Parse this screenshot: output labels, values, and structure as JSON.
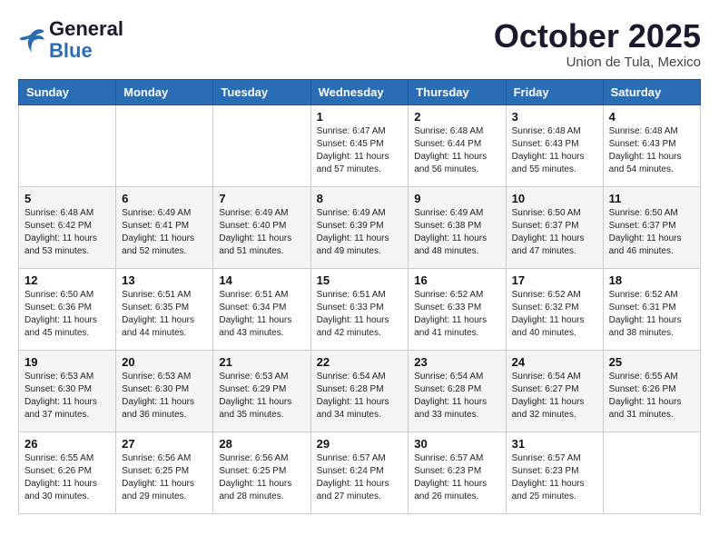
{
  "header": {
    "logo_line1": "General",
    "logo_line2": "Blue",
    "month": "October 2025",
    "location": "Union de Tula, Mexico"
  },
  "weekdays": [
    "Sunday",
    "Monday",
    "Tuesday",
    "Wednesday",
    "Thursday",
    "Friday",
    "Saturday"
  ],
  "weeks": [
    [
      {
        "day": "",
        "info": ""
      },
      {
        "day": "",
        "info": ""
      },
      {
        "day": "",
        "info": ""
      },
      {
        "day": "1",
        "info": "Sunrise: 6:47 AM\nSunset: 6:45 PM\nDaylight: 11 hours\nand 57 minutes."
      },
      {
        "day": "2",
        "info": "Sunrise: 6:48 AM\nSunset: 6:44 PM\nDaylight: 11 hours\nand 56 minutes."
      },
      {
        "day": "3",
        "info": "Sunrise: 6:48 AM\nSunset: 6:43 PM\nDaylight: 11 hours\nand 55 minutes."
      },
      {
        "day": "4",
        "info": "Sunrise: 6:48 AM\nSunset: 6:43 PM\nDaylight: 11 hours\nand 54 minutes."
      }
    ],
    [
      {
        "day": "5",
        "info": "Sunrise: 6:48 AM\nSunset: 6:42 PM\nDaylight: 11 hours\nand 53 minutes."
      },
      {
        "day": "6",
        "info": "Sunrise: 6:49 AM\nSunset: 6:41 PM\nDaylight: 11 hours\nand 52 minutes."
      },
      {
        "day": "7",
        "info": "Sunrise: 6:49 AM\nSunset: 6:40 PM\nDaylight: 11 hours\nand 51 minutes."
      },
      {
        "day": "8",
        "info": "Sunrise: 6:49 AM\nSunset: 6:39 PM\nDaylight: 11 hours\nand 49 minutes."
      },
      {
        "day": "9",
        "info": "Sunrise: 6:49 AM\nSunset: 6:38 PM\nDaylight: 11 hours\nand 48 minutes."
      },
      {
        "day": "10",
        "info": "Sunrise: 6:50 AM\nSunset: 6:37 PM\nDaylight: 11 hours\nand 47 minutes."
      },
      {
        "day": "11",
        "info": "Sunrise: 6:50 AM\nSunset: 6:37 PM\nDaylight: 11 hours\nand 46 minutes."
      }
    ],
    [
      {
        "day": "12",
        "info": "Sunrise: 6:50 AM\nSunset: 6:36 PM\nDaylight: 11 hours\nand 45 minutes."
      },
      {
        "day": "13",
        "info": "Sunrise: 6:51 AM\nSunset: 6:35 PM\nDaylight: 11 hours\nand 44 minutes."
      },
      {
        "day": "14",
        "info": "Sunrise: 6:51 AM\nSunset: 6:34 PM\nDaylight: 11 hours\nand 43 minutes."
      },
      {
        "day": "15",
        "info": "Sunrise: 6:51 AM\nSunset: 6:33 PM\nDaylight: 11 hours\nand 42 minutes."
      },
      {
        "day": "16",
        "info": "Sunrise: 6:52 AM\nSunset: 6:33 PM\nDaylight: 11 hours\nand 41 minutes."
      },
      {
        "day": "17",
        "info": "Sunrise: 6:52 AM\nSunset: 6:32 PM\nDaylight: 11 hours\nand 40 minutes."
      },
      {
        "day": "18",
        "info": "Sunrise: 6:52 AM\nSunset: 6:31 PM\nDaylight: 11 hours\nand 38 minutes."
      }
    ],
    [
      {
        "day": "19",
        "info": "Sunrise: 6:53 AM\nSunset: 6:30 PM\nDaylight: 11 hours\nand 37 minutes."
      },
      {
        "day": "20",
        "info": "Sunrise: 6:53 AM\nSunset: 6:30 PM\nDaylight: 11 hours\nand 36 minutes."
      },
      {
        "day": "21",
        "info": "Sunrise: 6:53 AM\nSunset: 6:29 PM\nDaylight: 11 hours\nand 35 minutes."
      },
      {
        "day": "22",
        "info": "Sunrise: 6:54 AM\nSunset: 6:28 PM\nDaylight: 11 hours\nand 34 minutes."
      },
      {
        "day": "23",
        "info": "Sunrise: 6:54 AM\nSunset: 6:28 PM\nDaylight: 11 hours\nand 33 minutes."
      },
      {
        "day": "24",
        "info": "Sunrise: 6:54 AM\nSunset: 6:27 PM\nDaylight: 11 hours\nand 32 minutes."
      },
      {
        "day": "25",
        "info": "Sunrise: 6:55 AM\nSunset: 6:26 PM\nDaylight: 11 hours\nand 31 minutes."
      }
    ],
    [
      {
        "day": "26",
        "info": "Sunrise: 6:55 AM\nSunset: 6:26 PM\nDaylight: 11 hours\nand 30 minutes."
      },
      {
        "day": "27",
        "info": "Sunrise: 6:56 AM\nSunset: 6:25 PM\nDaylight: 11 hours\nand 29 minutes."
      },
      {
        "day": "28",
        "info": "Sunrise: 6:56 AM\nSunset: 6:25 PM\nDaylight: 11 hours\nand 28 minutes."
      },
      {
        "day": "29",
        "info": "Sunrise: 6:57 AM\nSunset: 6:24 PM\nDaylight: 11 hours\nand 27 minutes."
      },
      {
        "day": "30",
        "info": "Sunrise: 6:57 AM\nSunset: 6:23 PM\nDaylight: 11 hours\nand 26 minutes."
      },
      {
        "day": "31",
        "info": "Sunrise: 6:57 AM\nSunset: 6:23 PM\nDaylight: 11 hours\nand 25 minutes."
      },
      {
        "day": "",
        "info": ""
      }
    ]
  ]
}
